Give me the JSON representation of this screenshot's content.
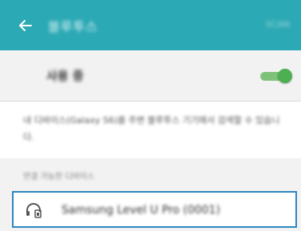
{
  "app_bar": {
    "title": "블루투스",
    "aux_text": "SCAN",
    "back_icon": "arrow-left-icon",
    "background": "#2ba9b5"
  },
  "bluetooth_toggle": {
    "label": "사용 중",
    "state": "on",
    "accent": "#4caf50"
  },
  "description": {
    "text": "내 디바이스(Galaxy S6)를 주변 블루투스 기기에서 검색할 수 있습니다."
  },
  "section": {
    "title": "연결 가능한 디바이스"
  },
  "devices": [
    {
      "name": "Samsung Level U Pro (0001)",
      "icon": "headset-icon",
      "highlight": "#2e86c1"
    }
  ]
}
